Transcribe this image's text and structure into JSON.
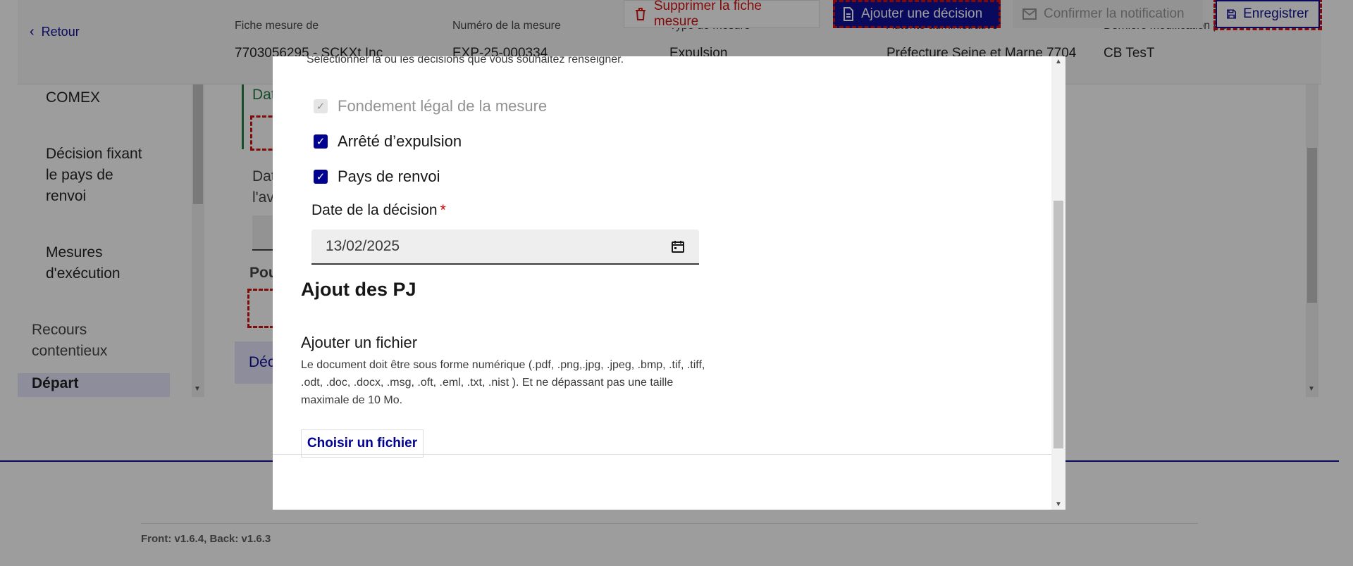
{
  "header": {
    "back_label": "Retour",
    "meta": [
      {
        "key": "Fiche mesure de",
        "value": "7703056295 - SCKXt Inc"
      },
      {
        "key": "Numéro de la mesure",
        "value": "EXP-25-000334"
      },
      {
        "key": "Type de mesure",
        "value": "Expulsion"
      },
      {
        "key": "Autorité administrative",
        "value": "Préfecture Seine et Marne 7704"
      },
      {
        "key": "Dernière modification par",
        "value": "CB TesT"
      }
    ]
  },
  "toolbar": {
    "delete_label": "Supprimer la fiche mesure",
    "add_decision_label": "Ajouter une décision",
    "confirm_label": "Confirmer la notification",
    "save_label": "Enregistrer"
  },
  "sidenav": {
    "items": [
      {
        "label": "COMEX"
      },
      {
        "label": "Décision fixant le pays de renvoi"
      },
      {
        "label": "Mesures d'exécution"
      },
      {
        "label": "Recours contentieux"
      },
      {
        "label": "Départ"
      }
    ]
  },
  "background_form": {
    "label_a": "Dat",
    "label_b": "Dat l'av",
    "label_c": "Pou",
    "tab_label": "Déc"
  },
  "footer": {
    "version": "Front: v1.6.4, Back: v1.6.3"
  },
  "modal": {
    "intro": "Sélectionner la ou les décisions que vous souhaitez renseigner.",
    "checkboxes": [
      {
        "label": "Fondement légal de la mesure",
        "checked": true,
        "disabled": true
      },
      {
        "label": "Arrêté d’expulsion",
        "checked": true,
        "disabled": false
      },
      {
        "label": "Pays de renvoi",
        "checked": true,
        "disabled": false
      }
    ],
    "date_label": "Date de la décision",
    "date_required_mark": "*",
    "date_value": "13/02/2025",
    "pj_title": "Ajout des PJ",
    "file_label": "Ajouter un fichier",
    "file_hint": "Le document doit être sous forme numérique (.pdf, .png,.jpg, .jpeg, .bmp, .tif, .tiff, .odt, .doc, .docx, .msg, .oft, .eml, .txt, .nist ). Et ne dépassant pas une taille maximale de 10 Mo.",
    "file_button": "Choisir un fichier"
  },
  "colors": {
    "primary": "#000091",
    "danger": "#ce0500",
    "overlay": "rgba(22,22,22,0.42)"
  },
  "icons": [
    "chevron-left-icon",
    "trash-icon",
    "document-icon",
    "mail-icon",
    "save-icon",
    "check-icon",
    "calendar-icon"
  ]
}
